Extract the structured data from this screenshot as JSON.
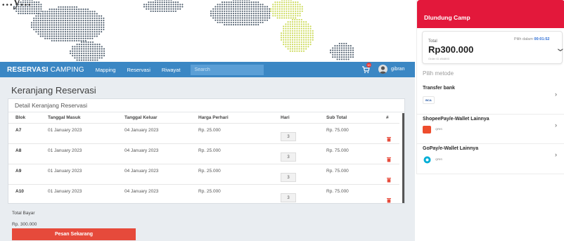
{
  "hero": {
    "title": "...y..."
  },
  "navbar": {
    "brand_bold": "RESERVASI",
    "brand_light": " CAMPING",
    "links": [
      "Mapping",
      "Reservasi",
      "Riwayat"
    ],
    "search_placeholder": "Search",
    "cart_badge": "10",
    "username": "gibran"
  },
  "main": {
    "page_title": "Keranjang Reservasi",
    "card_title": "Detail Keranjang Reservasi",
    "columns": [
      "Blok",
      "Tanggal Masuk",
      "Tanggal Keluar",
      "Harga Perhari",
      "Hari",
      "Sub Total",
      "#"
    ],
    "rows": [
      {
        "blok": "A7",
        "masuk": "01 January 2023",
        "keluar": "04 January 2023",
        "harga": "Rp. 25.000",
        "hari": "3",
        "subtotal": "Rp. 75.000"
      },
      {
        "blok": "A8",
        "masuk": "01 January 2023",
        "keluar": "04 January 2023",
        "harga": "Rp. 25.000",
        "hari": "3",
        "subtotal": "Rp. 75.000"
      },
      {
        "blok": "A9",
        "masuk": "01 January 2023",
        "keluar": "04 January 2023",
        "harga": "Rp. 25.000",
        "hari": "3",
        "subtotal": "Rp. 75.000"
      },
      {
        "blok": "A10",
        "masuk": "01 January 2023",
        "keluar": "04 January 2023",
        "harga": "Rp. 25.000",
        "hari": "3",
        "subtotal": "Rp. 75.000"
      }
    ],
    "total_label": "Total Bayar",
    "total_value": "Rp. 300.000",
    "order_button": "Pesan Sekarang"
  },
  "payment": {
    "merchant": "Dlundung Camp",
    "total_label": "Total",
    "amount": "Rp300.000",
    "order_id": "Order ID #54893",
    "timer_prefix": "Pilih dalam ",
    "timer": "00:01:52",
    "method_heading": "Pilih metode",
    "methods": [
      {
        "title": "Transfer bank",
        "logo": "BCA"
      },
      {
        "title": "ShopeePay/e-Wallet Lainnya",
        "logo": "QRIS"
      },
      {
        "title": "GoPay/e-Wallet Lainnya",
        "logo": "QRIS"
      }
    ]
  },
  "colors": {
    "navbar": "#3b87c4",
    "payment_header": "#e3183b",
    "order_button": "#e64a3b",
    "map_dots": "#4b5a6a",
    "map_highlight": "#c8d84e",
    "trash": "#e74c3c"
  },
  "icons": {
    "cart": "cart-icon",
    "avatar": "user-avatar-icon",
    "trash": "trash-icon",
    "chevron": "chevron-right-icon"
  }
}
